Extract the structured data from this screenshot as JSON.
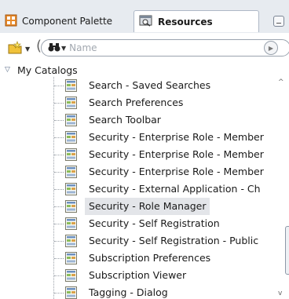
{
  "tabs": {
    "palette_label": "Component Palette",
    "resources_label": "Resources"
  },
  "toolbar": {
    "search_placeholder": "Name"
  },
  "catalogs": {
    "label": "My Catalogs"
  },
  "tree": {
    "items": [
      {
        "label": "Search - Saved Searches"
      },
      {
        "label": "Search Preferences"
      },
      {
        "label": "Search Toolbar"
      },
      {
        "label": "Security - Enterprise Role - Member"
      },
      {
        "label": "Security - Enterprise Role - Member"
      },
      {
        "label": "Security - Enterprise Role - Member"
      },
      {
        "label": "Security - External Application - Ch"
      },
      {
        "label": "Security - Role Manager",
        "selected": true
      },
      {
        "label": "Security - Self Registration"
      },
      {
        "label": "Security - Self Registration - Public"
      },
      {
        "label": "Subscription Preferences"
      },
      {
        "label": "Subscription Viewer"
      },
      {
        "label": "Tagging - Dialog"
      }
    ]
  },
  "colors": {
    "accent": "#5a6d88",
    "selection": "#e3e5e9"
  }
}
